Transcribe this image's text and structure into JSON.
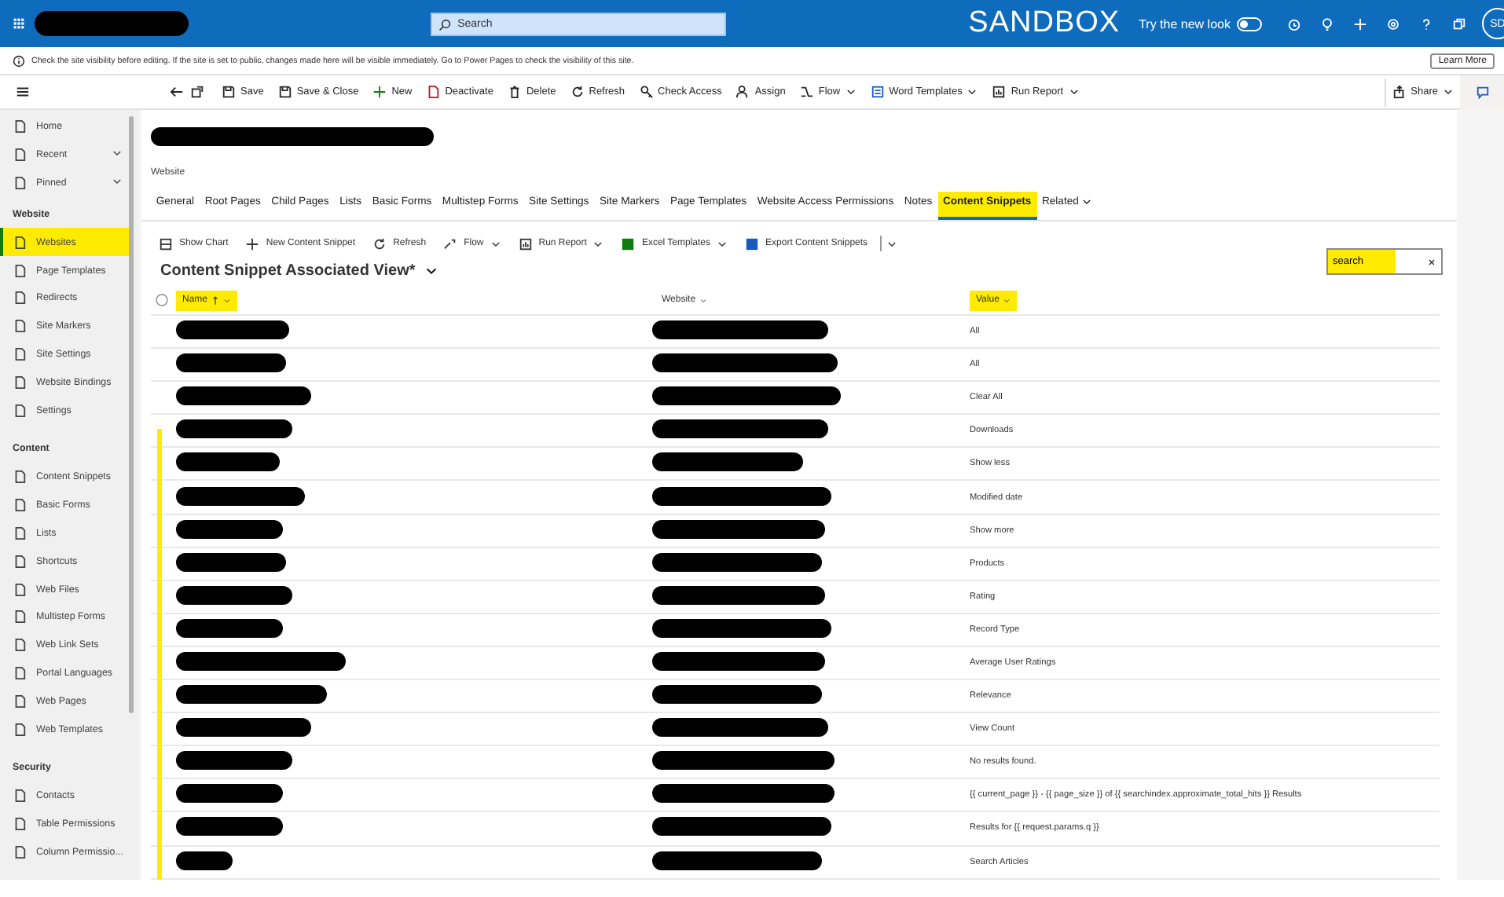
{
  "top_bar": {
    "app_name_redacted": true,
    "search": {
      "placeholder": "Search"
    },
    "environment": "SANDBOX",
    "new_look": {
      "label": "Try the new look",
      "on": false
    },
    "avatar": "SD"
  },
  "notice": {
    "text": "Check the site visibility before editing. If the site is set to public, changes made here will be visible immediately. Go to Power Pages to check the visibility of this site.",
    "button": "Learn More"
  },
  "command_bar": {
    "items": [
      {
        "label": "Save",
        "dropdown": false
      },
      {
        "label": "Save & Close",
        "dropdown": false
      },
      {
        "label": "New",
        "dropdown": false
      },
      {
        "label": "Deactivate",
        "dropdown": false
      },
      {
        "label": "Delete",
        "dropdown": false
      },
      {
        "label": "Refresh",
        "dropdown": false
      },
      {
        "label": "Check Access",
        "dropdown": false
      },
      {
        "label": "Assign",
        "dropdown": false
      },
      {
        "label": "Flow",
        "dropdown": true
      },
      {
        "label": "Word Templates",
        "dropdown": true
      },
      {
        "label": "Run Report",
        "dropdown": true
      }
    ],
    "share": "Share"
  },
  "sidebar": {
    "top_items": [
      {
        "label": "Home",
        "expandable": false
      },
      {
        "label": "Recent",
        "expandable": true
      },
      {
        "label": "Pinned",
        "expandable": true
      }
    ],
    "sections": [
      {
        "title": "Website",
        "items": [
          {
            "label": "Websites",
            "selected": true,
            "highlighted": true
          },
          {
            "label": "Page Templates",
            "selected": false,
            "highlighted": false
          },
          {
            "label": "Redirects",
            "selected": false,
            "highlighted": false
          },
          {
            "label": "Site Markers",
            "selected": false,
            "highlighted": false
          },
          {
            "label": "Site Settings",
            "selected": false,
            "highlighted": false
          },
          {
            "label": "Website Bindings",
            "selected": false,
            "highlighted": false
          },
          {
            "label": "Settings",
            "selected": false,
            "highlighted": false
          }
        ]
      },
      {
        "title": "Content",
        "items": [
          {
            "label": "Content Snippets",
            "selected": false,
            "highlighted": false
          },
          {
            "label": "Basic Forms",
            "selected": false,
            "highlighted": false
          },
          {
            "label": "Lists",
            "selected": false,
            "highlighted": false
          },
          {
            "label": "Shortcuts",
            "selected": false,
            "highlighted": false
          },
          {
            "label": "Web Files",
            "selected": false,
            "highlighted": false
          },
          {
            "label": "Multistep Forms",
            "selected": false,
            "highlighted": false
          },
          {
            "label": "Web Link Sets",
            "selected": false,
            "highlighted": false
          },
          {
            "label": "Portal Languages",
            "selected": false,
            "highlighted": false
          },
          {
            "label": "Web Pages",
            "selected": false,
            "highlighted": false
          },
          {
            "label": "Web Templates",
            "selected": false,
            "highlighted": false
          }
        ]
      },
      {
        "title": "Security",
        "items": [
          {
            "label": "Contacts",
            "selected": false,
            "highlighted": false
          },
          {
            "label": "Table Permissions",
            "selected": false,
            "highlighted": false
          },
          {
            "label": "Column Permissio...",
            "selected": false,
            "highlighted": false
          }
        ]
      }
    ]
  },
  "record": {
    "title_redacted": true,
    "entity": "Website",
    "tabs": [
      {
        "label": "General",
        "selected": false,
        "highlighted": false
      },
      {
        "label": "Root Pages",
        "selected": false,
        "highlighted": false
      },
      {
        "label": "Child Pages",
        "selected": false,
        "highlighted": false
      },
      {
        "label": "Lists",
        "selected": false,
        "highlighted": false
      },
      {
        "label": "Basic Forms",
        "selected": false,
        "highlighted": false
      },
      {
        "label": "Multistep Forms",
        "selected": false,
        "highlighted": false
      },
      {
        "label": "Site Settings",
        "selected": false,
        "highlighted": false
      },
      {
        "label": "Site Markers",
        "selected": false,
        "highlighted": false
      },
      {
        "label": "Page Templates",
        "selected": false,
        "highlighted": false
      },
      {
        "label": "Website Access Permissions",
        "selected": false,
        "highlighted": false
      },
      {
        "label": "Notes",
        "selected": false,
        "highlighted": false
      },
      {
        "label": "Content Snippets",
        "selected": true,
        "highlighted": true
      },
      {
        "label": "Related",
        "selected": false,
        "highlighted": false,
        "dropdown": true
      }
    ]
  },
  "subgrid": {
    "commands": [
      {
        "label": "Show Chart",
        "dropdown": false
      },
      {
        "label": "New Content Snippet",
        "dropdown": false
      },
      {
        "label": "Refresh",
        "dropdown": false
      },
      {
        "label": "Flow",
        "dropdown": true
      },
      {
        "label": "Run Report",
        "dropdown": true
      },
      {
        "label": "Excel Templates",
        "dropdown": true
      },
      {
        "label": "Export Content Snippets",
        "dropdown": false
      }
    ],
    "view_title": "Content Snippet Associated View*",
    "search": {
      "value": "search",
      "highlighted": true
    },
    "columns": [
      {
        "label": "Name",
        "sorted": true,
        "highlighted": true
      },
      {
        "label": "Website",
        "sorted": false,
        "highlighted": false
      },
      {
        "label": "Value",
        "sorted": false,
        "highlighted": true
      }
    ],
    "select_all_checked": false,
    "rows_highlighted": true,
    "rows": [
      {
        "name_redacted": true,
        "website_redacted": true,
        "value": "All"
      },
      {
        "name_redacted": true,
        "website_redacted": true,
        "value": "All"
      },
      {
        "name_redacted": true,
        "website_redacted": true,
        "value": "Clear All"
      },
      {
        "name_redacted": true,
        "website_redacted": true,
        "value": "Downloads"
      },
      {
        "name_redacted": true,
        "website_redacted": true,
        "value": "Show less"
      },
      {
        "name_redacted": true,
        "website_redacted": true,
        "value": "Modified date"
      },
      {
        "name_redacted": true,
        "website_redacted": true,
        "value": "Show more"
      },
      {
        "name_redacted": true,
        "website_redacted": true,
        "value": "Products"
      },
      {
        "name_redacted": true,
        "website_redacted": true,
        "value": "Rating"
      },
      {
        "name_redacted": true,
        "website_redacted": true,
        "value": "Record Type"
      },
      {
        "name_redacted": true,
        "website_redacted": true,
        "value": "Average User Ratings"
      },
      {
        "name_redacted": true,
        "website_redacted": true,
        "value": "Relevance"
      },
      {
        "name_redacted": true,
        "website_redacted": true,
        "value": "View Count"
      },
      {
        "name_redacted": true,
        "website_redacted": true,
        "value": "No results found."
      },
      {
        "name_redacted": true,
        "website_redacted": true,
        "value": "{{ current_page }} - {{ page_size }} of {{ searchindex.approximate_total_hits }} Results"
      },
      {
        "name_redacted": true,
        "website_redacted": true,
        "value": "Results for {{ request.params.q }}"
      },
      {
        "name_redacted": true,
        "website_redacted": true,
        "value": "Search Articles"
      }
    ]
  }
}
